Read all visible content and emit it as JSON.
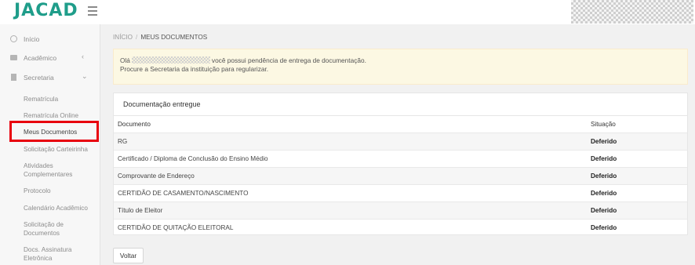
{
  "header": {
    "logo": "JACAD"
  },
  "sidebar": {
    "items": [
      {
        "label": "Início",
        "icon": "home-circle-icon"
      },
      {
        "label": "Acadêmico",
        "icon": "briefcase-icon",
        "chevron": "‹"
      },
      {
        "label": "Secretaria",
        "icon": "document-icon",
        "chevron": "⌄"
      }
    ],
    "submenu": [
      "Rematrícula",
      "Rematrícula Online",
      "Meus Documentos",
      "Solicitação Carteirinha",
      "Atividades Complementares",
      "Protocolo",
      "Calendário Acadêmico",
      "Solicitação de Documentos",
      "Docs. Assinatura Eletrônica"
    ]
  },
  "breadcrumb": {
    "home": "INÍCIO",
    "separator": "/",
    "current": "MEUS DOCUMENTOS"
  },
  "alert": {
    "greeting": "Olá",
    "message_rest": "você possui pendência de entrega de documentação.",
    "line2": "Procure a Secretaria da instituição para regularizar."
  },
  "panel": {
    "title": "Documentação entregue",
    "columns": {
      "document": "Documento",
      "status": "Situação"
    },
    "rows": [
      {
        "document": "RG",
        "status": "Deferido"
      },
      {
        "document": "Certificado / Diploma de Conclusão do Ensino Médio",
        "status": "Deferido"
      },
      {
        "document": "Comprovante de Endereço",
        "status": "Deferido"
      },
      {
        "document": "CERTIDÃO DE CASAMENTO/NASCIMENTO",
        "status": "Deferido"
      },
      {
        "document": "Título de Eleitor",
        "status": "Deferido"
      },
      {
        "document": "CERTIDÃO DE QUITAÇÃO ELEITORAL",
        "status": "Deferido"
      }
    ]
  },
  "actions": {
    "back": "Voltar"
  },
  "colors": {
    "brand": "#1f9d8a",
    "highlight": "#e8000d",
    "alert_bg": "#fcf8e3"
  }
}
